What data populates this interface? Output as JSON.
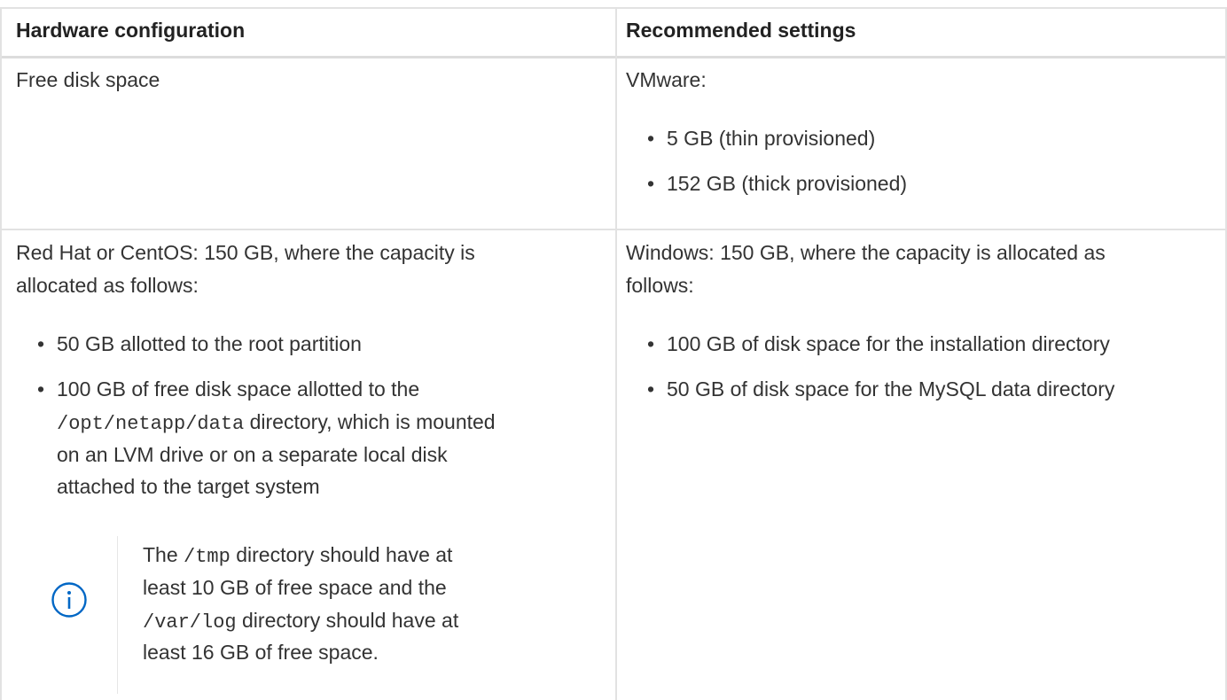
{
  "table": {
    "headers": [
      "Hardware configuration",
      "Recommended settings"
    ],
    "row1": {
      "left": "Free disk space",
      "right_intro": "VMware:",
      "right_bullets": [
        "5 GB (thin provisioned)",
        "152 GB (thick provisioned)"
      ]
    },
    "row2": {
      "left_intro_line1": "Red Hat or CentOS: 150 GB, where the capacity is",
      "left_intro_line2": "allocated as follows:",
      "left_bullet1": "50 GB allotted to the root partition",
      "left_bullet2_line1": "100 GB of free disk space allotted to the",
      "left_bullet2_code": "/opt/netapp/data",
      "left_bullet2_line2_rest": " directory, which is mounted",
      "left_bullet2_line3": "on an LVM drive or on a separate local disk",
      "left_bullet2_line4": "attached to the target system",
      "note": {
        "icon": "info-icon",
        "line1_pre": "The ",
        "line1_code": "/tmp",
        "line1_post": " directory should have at",
        "line2": "least 10 GB of free space and the",
        "line3_code": "/var/log",
        "line3_post": " directory should have at",
        "line4": "least 16 GB of free space."
      },
      "right_intro_line1": "Windows: 150 GB, where the capacity is allocated as",
      "right_intro_line2": "follows:",
      "right_bullets": [
        "100 GB of disk space for the installation directory",
        "50 GB of disk space for the MySQL data directory"
      ]
    },
    "colors": {
      "border": "#e2e2e2",
      "text": "#333333",
      "icon": "#0067c5"
    }
  }
}
